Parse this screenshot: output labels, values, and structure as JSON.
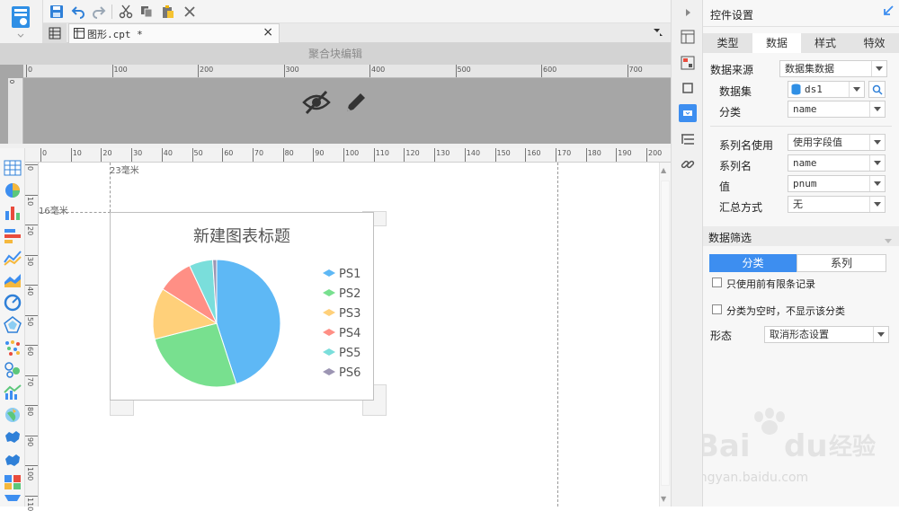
{
  "toolbar": {
    "save_icon": "save-icon",
    "undo_icon": "undo-icon",
    "redo_icon": "redo-icon",
    "cut_icon": "cut-icon",
    "copy_icon": "copy-icon",
    "paste_icon": "paste-icon",
    "delete_icon": "delete-icon"
  },
  "tab": {
    "title": "图形.cpt *",
    "close": "×"
  },
  "header": {
    "title": "聚合块编辑"
  },
  "ruler_top": [
    "0",
    "100",
    "200",
    "300",
    "400",
    "500",
    "600",
    "700"
  ],
  "ruler_design_h": [
    "0",
    "10",
    "20",
    "30",
    "40",
    "50",
    "60",
    "70",
    "80",
    "90",
    "100",
    "110",
    "120",
    "130",
    "140",
    "150",
    "160",
    "170",
    "180",
    "190",
    "200"
  ],
  "ruler_design_v": [
    "0",
    "10",
    "20",
    "30",
    "40",
    "50",
    "60",
    "70",
    "80",
    "90",
    "100",
    "110"
  ],
  "canvas": {
    "label_x": "23毫米",
    "label_y": "16毫米"
  },
  "chart_data": {
    "type": "pie",
    "title": "新建图表标题",
    "categories": [
      "PS1",
      "PS2",
      "PS3",
      "PS4",
      "PS5",
      "PS6"
    ],
    "values": [
      45,
      26,
      13,
      9,
      6,
      1
    ],
    "colors": [
      "#5eb8f5",
      "#78e08f",
      "#ffd07a",
      "#ff8f85",
      "#7adedb",
      "#9c95b3"
    ],
    "legend": "right"
  },
  "panel": {
    "title": "控件设置",
    "tabs": [
      "类型",
      "数据",
      "样式",
      "特效"
    ],
    "active_tab": "数据",
    "data_source_label": "数据来源",
    "data_source_value": "数据集数据",
    "dataset_label": "数据集",
    "dataset_value": "ds1",
    "category_label": "分类",
    "category_value": "name",
    "series_name_use_label": "系列名使用",
    "series_name_use_value": "使用字段值",
    "series_name_label": "系列名",
    "series_name_value": "name",
    "value_label": "值",
    "value_value": "pnum",
    "summary_label": "汇总方式",
    "summary_value": "无",
    "filter_section": "数据筛选",
    "filter_tab_category": "分类",
    "filter_tab_series": "系列",
    "check1": "只使用前有限条记录",
    "check2": "分类为空时，不显示该分类",
    "form_label": "形态",
    "form_value": "取消形态设置"
  },
  "colors": {
    "accent": "#3d8ef0",
    "upper_bg": "#a6a6a6",
    "header_bg": "#d3d3d3"
  },
  "watermark": "Baidu经验 jingyan.baidu.com"
}
